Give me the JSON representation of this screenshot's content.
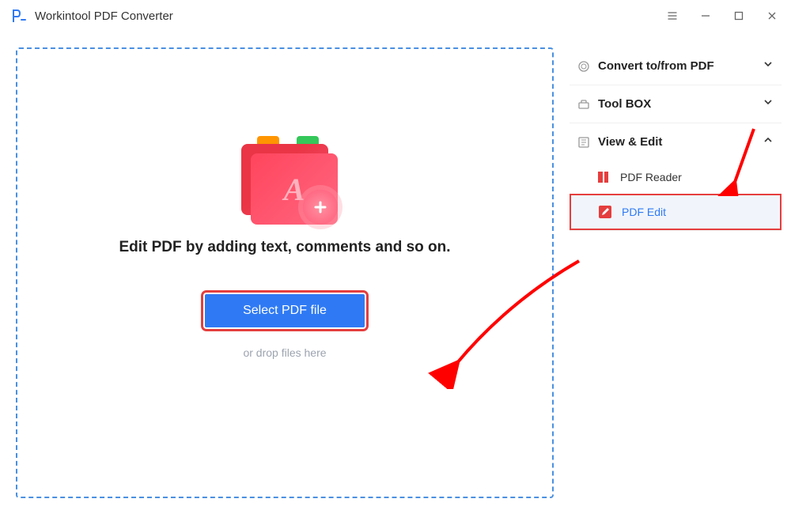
{
  "app": {
    "title": "Workintool PDF Converter"
  },
  "main": {
    "headline": "Edit PDF by adding text, comments and so on.",
    "select_button": "Select PDF file",
    "drop_hint": "or drop files here"
  },
  "sidebar": {
    "sections": {
      "convert": {
        "title": "Convert to/from PDF",
        "expanded": false
      },
      "toolbox": {
        "title": "Tool BOX",
        "expanded": false
      },
      "viewedit": {
        "title": "View & Edit",
        "expanded": true
      }
    },
    "viewedit_items": {
      "reader": {
        "label": "PDF Reader"
      },
      "edit": {
        "label": "PDF Edit"
      }
    }
  }
}
